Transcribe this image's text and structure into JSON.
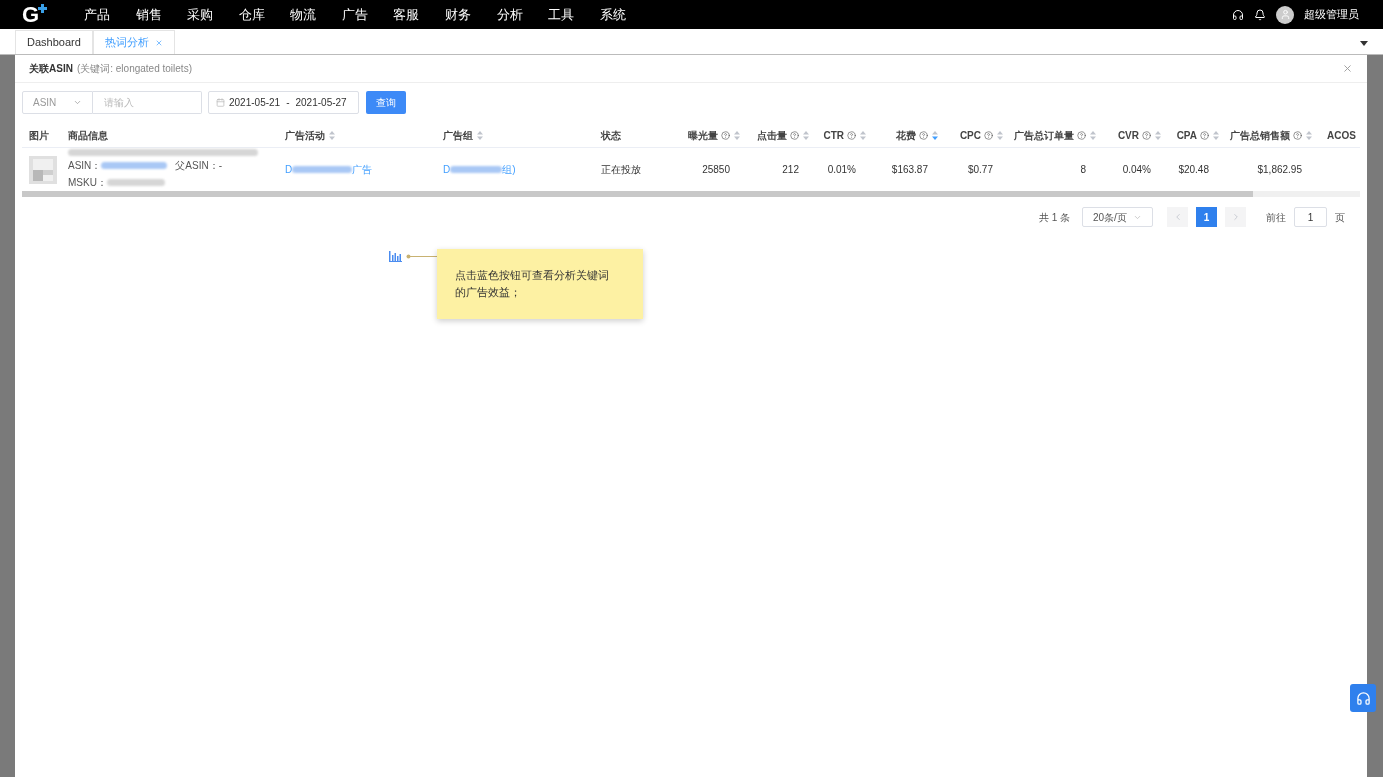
{
  "topbar": {
    "logo": "G",
    "menu": [
      "产品",
      "销售",
      "采购",
      "仓库",
      "物流",
      "广告",
      "客服",
      "财务",
      "分析",
      "工具",
      "系统"
    ],
    "user": "超级管理员"
  },
  "tabs": [
    {
      "label": "Dashboard",
      "selected": false,
      "closable": false
    },
    {
      "label": "热词分析",
      "selected": true,
      "closable": true
    }
  ],
  "panel": {
    "title": "关联ASIN",
    "subtitle": "(关键词: elongated toilets)"
  },
  "filters": {
    "field_type": "ASIN",
    "search_placeholder": "请输入",
    "date_from": "2021-05-21",
    "date_sep": "-",
    "date_to": "2021-05-27",
    "query_button": "查询"
  },
  "table": {
    "columns": [
      {
        "kind": "text",
        "label": "图片",
        "help": false,
        "sortable": false
      },
      {
        "kind": "text",
        "label": "商品信息",
        "help": false,
        "sortable": false
      },
      {
        "kind": "text",
        "label": "广告活动",
        "help": false,
        "sortable": true,
        "sorted": false
      },
      {
        "kind": "text",
        "label": "广告组",
        "help": false,
        "sortable": true,
        "sorted": false
      },
      {
        "kind": "text",
        "label": "状态",
        "help": false,
        "sortable": false
      },
      {
        "kind": "metric",
        "label": "曝光量",
        "help": true,
        "sortable": true,
        "sorted": false
      },
      {
        "kind": "metric",
        "label": "点击量",
        "help": true,
        "sortable": true,
        "sorted": false
      },
      {
        "kind": "metric",
        "label": "CTR",
        "help": true,
        "sortable": true,
        "sorted": false
      },
      {
        "kind": "metric",
        "label": "花费",
        "help": true,
        "sortable": true,
        "sorted": true
      },
      {
        "kind": "metric",
        "label": "CPC",
        "help": true,
        "sortable": true,
        "sorted": false
      },
      {
        "kind": "metric",
        "label": "广告总订单量",
        "help": true,
        "sortable": true,
        "sorted": false
      },
      {
        "kind": "metric",
        "label": "CVR",
        "help": true,
        "sortable": true,
        "sorted": false
      },
      {
        "kind": "metric",
        "label": "CPA",
        "help": true,
        "sortable": true,
        "sorted": false
      },
      {
        "kind": "metric",
        "label": "广告总销售额",
        "help": true,
        "sortable": true,
        "sorted": false
      },
      {
        "kind": "text",
        "label": "ACOS",
        "help": false,
        "sortable": false
      }
    ],
    "rows": [
      {
        "asin_label": "ASIN：",
        "parent_asin": "父ASIN：-",
        "msku_label": "MSKU：",
        "campaign_start": "D",
        "campaign_end": "广告",
        "group_start": "D",
        "group_end": "组)",
        "status": "正在投放",
        "metrics": [
          "25850",
          "212",
          "0.01%",
          "$163.87",
          "$0.77",
          "8",
          "0.04%",
          "$20.48",
          "$1,862.95"
        ]
      }
    ]
  },
  "pagination": {
    "total": "共 1 条",
    "page_size": "20条/页",
    "pages": [
      {
        "label": "1",
        "selected": true
      }
    ],
    "prev_disabled": true,
    "goto_label": "前往",
    "goto_value": "1",
    "goto_suffix": "页"
  },
  "guide": {
    "text": "点击蓝色按钮可查看分析关键词的广告效益；"
  }
}
